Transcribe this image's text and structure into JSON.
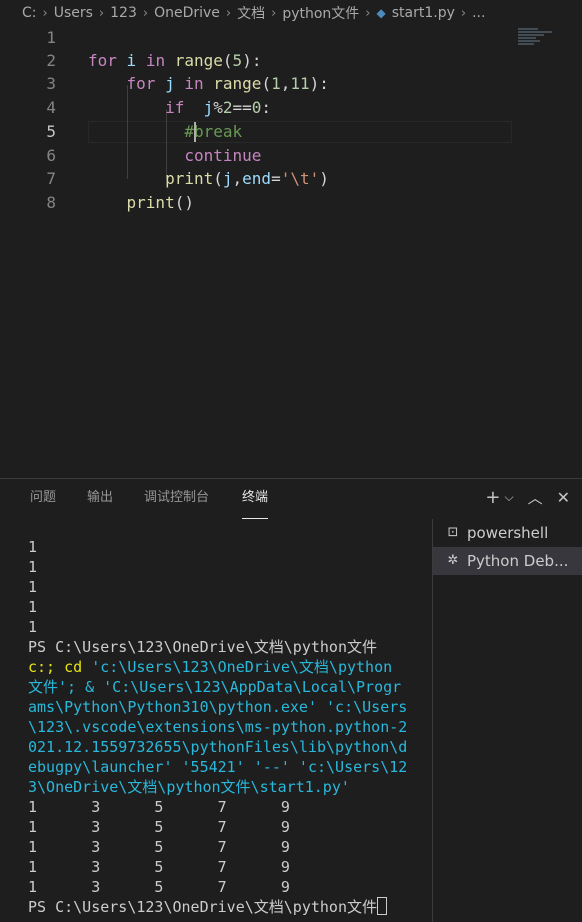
{
  "breadcrumb": {
    "segments": [
      "C:",
      "Users",
      "123",
      "OneDrive",
      "文档",
      "python文件"
    ],
    "file": "start1.py",
    "trailing": "..."
  },
  "editor": {
    "line_numbers": [
      "1",
      "2",
      "3",
      "4",
      "5",
      "6",
      "7",
      "8"
    ],
    "active_line": 5
  },
  "panel": {
    "tabs": [
      "问题",
      "输出",
      "调试控制台",
      "终端"
    ],
    "active_tab": "终端",
    "terminal_lines": [
      "1",
      "1",
      "1",
      "1",
      "1",
      "PS C:\\Users\\123\\OneDrive\\文档\\python文件",
      "c:; cd 'c:\\Users\\123\\OneDrive\\文档\\python",
      "文件'; & 'C:\\Users\\123\\AppData\\Local\\Progr",
      "ams\\Python\\Python310\\python.exe' 'c:\\Users",
      "\\123\\.vscode\\extensions\\ms-python.python-2",
      "021.12.1559732655\\pythonFiles\\lib\\python\\d",
      "ebugpy\\launcher' '55421' '--' 'c:\\Users\\12",
      "3\\OneDrive\\文档\\python文件\\start1.py'",
      "1      3      5      7      9",
      "1      3      5      7      9",
      "1      3      5      7      9",
      "1      3      5      7      9",
      "1      3      5      7      9",
      "PS C:\\Users\\123\\OneDrive\\文档\\python文件"
    ],
    "terminals": [
      "powershell",
      "Python Deb..."
    ]
  }
}
